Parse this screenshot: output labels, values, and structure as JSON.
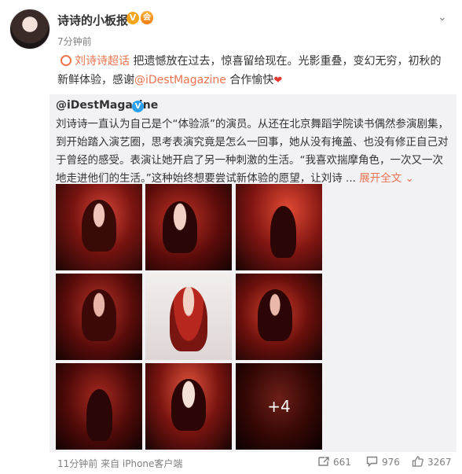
{
  "post": {
    "author": "诗诗的小板报",
    "verified_badge": "V",
    "vip_badge": "会",
    "time": "7分钟前",
    "topic": "刘诗诗超话",
    "text_1": "把遗憾放在过去，惊喜留给现在。光影重叠，变幻无穷，初秋的新鲜体验，感谢",
    "mention": "@iDestMagazine",
    "text_2": " 合作愉快",
    "heart": "❤"
  },
  "repost": {
    "author": "@iDestMagazine",
    "verified_badge": "V",
    "text": "刘诗诗一直认为自己是个“体验派”的演员。从还在北京舞蹈学院读书偶然参演剧集，到开始踏入演艺圈，思考表演究竟是怎么一回事，她从没有掩盖、也没有修正自己对于曾经的感受。表演让她开启了另一种刺激的生活。“我喜欢揣摩角色，一次又一次地走进他们的生活。”这种始终想要尝试新体验的愿望，让刘诗 ...",
    "expand": "展开全文 ⌄",
    "more_photos": "+4"
  },
  "footer": {
    "source": "11分钟前 来自 iPhone客户端",
    "repost_count": "661",
    "comment_count": "976",
    "like_count": "3267"
  },
  "colors": {
    "accent": "#eb7350",
    "muted": "#808080",
    "repost_bg": "#f2f2f5"
  }
}
